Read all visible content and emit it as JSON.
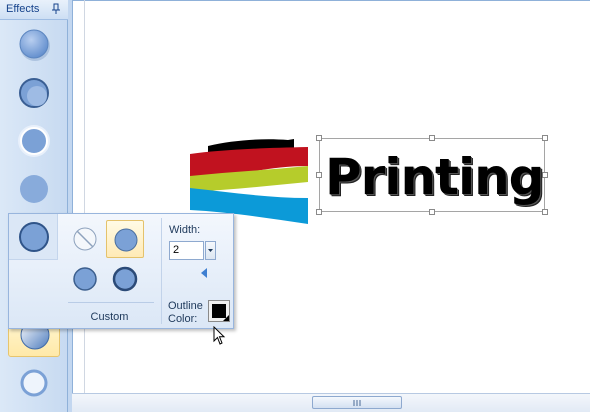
{
  "effects_panel": {
    "title": "Effects",
    "buttons": [
      "shadow-effect",
      "inner-shadow-effect",
      "glow-effect",
      "soft-edge-effect",
      "outline-effect",
      "text-effect",
      "bevel-effect",
      "ring-effect"
    ]
  },
  "flyout": {
    "width_label": "Width:",
    "width_value": "2",
    "outline_label_line1": "Outline",
    "outline_label_line2": "Color:",
    "custom_label": "Custom",
    "outline_color": "#000000"
  },
  "logo": {
    "text": "Printing",
    "stripe_colors": [
      "#000000",
      "#c1121f",
      "#b6cc2b",
      "#0c9ad8"
    ]
  },
  "scrollbar": {
    "grip": "|||"
  }
}
